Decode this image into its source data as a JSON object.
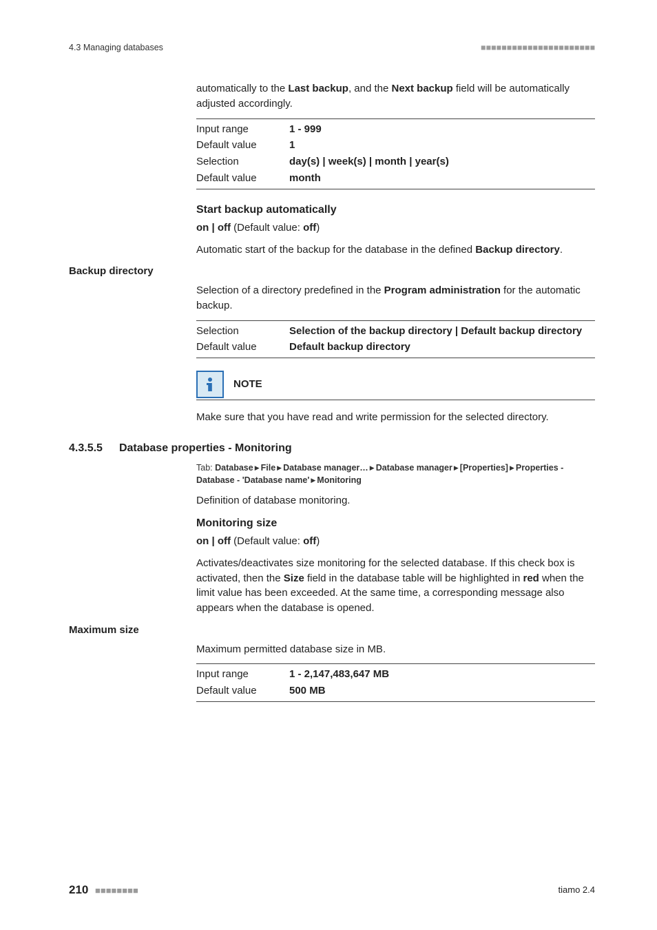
{
  "header": {
    "left": "4.3 Managing databases",
    "right": "■■■■■■■■■■■■■■■■■■■■■■"
  },
  "intro": {
    "p1_a": "automatically to the ",
    "p1_b": "Last backup",
    "p1_c": ", and the ",
    "p1_d": "Next backup",
    "p1_e": " field will be automatically adjusted accordingly."
  },
  "table1": {
    "r1_label": "Input range",
    "r1_value": "1 - 999",
    "r2_label": "Default value",
    "r2_value": "1",
    "r3_label": "Selection",
    "r3_value": "day(s) | week(s) | month | year(s)",
    "r4_label": "Default value",
    "r4_value": "month"
  },
  "start_backup": {
    "heading": "Start backup automatically",
    "onoff_a": "on | off",
    "onoff_b": " (Default value: ",
    "onoff_c": "off",
    "onoff_d": ")",
    "desc_a": "Automatic start of the backup for the database in the defined ",
    "desc_b": "Backup directory",
    "desc_c": "."
  },
  "backup_dir": {
    "side": "Backup directory",
    "desc_a": "Selection of a directory predefined in the ",
    "desc_b": "Program administration",
    "desc_c": " for the automatic backup."
  },
  "table2": {
    "r1_label": "Selection",
    "r1_value": "Selection of the backup directory | Default backup directory",
    "r2_label": "Default value",
    "r2_value": "Default backup directory"
  },
  "note": {
    "title": "NOTE",
    "body": "Make sure that you have read and write permission for the selected directory."
  },
  "section": {
    "num": "4.3.5.5",
    "title": "Database properties - Monitoring"
  },
  "tabline": {
    "lead": "Tab: ",
    "p1": "Database",
    "p2": "File",
    "p3": "Database manager…",
    "p4": "Database manager",
    "p5": "[Properties]",
    "p6": "Properties - Database - 'Database name'",
    "p7": "Monitoring"
  },
  "monitor": {
    "def": "Definition of database monitoring.",
    "heading": "Monitoring size",
    "onoff_a": "on | off",
    "onoff_b": " (Default value: ",
    "onoff_c": "off",
    "onoff_d": ")",
    "desc_a": "Activates/deactivates size monitoring for the selected database. If this check box is activated, then the ",
    "desc_b": "Size",
    "desc_c": " field in the database table will be highlighted in ",
    "desc_d": "red",
    "desc_e": " when the limit value has been exceeded. At the same time, a corresponding message also appears when the database is opened."
  },
  "maxsize": {
    "side": "Maximum size",
    "desc": "Maximum permitted database size in MB."
  },
  "table3": {
    "r1_label": "Input range",
    "r1_value": "1 - 2,147,483,647 MB",
    "r2_label": "Default value",
    "r2_value": "500 MB"
  },
  "footer": {
    "page": "210",
    "dashes": "■■■■■■■■",
    "right": "tiamo 2.4"
  }
}
